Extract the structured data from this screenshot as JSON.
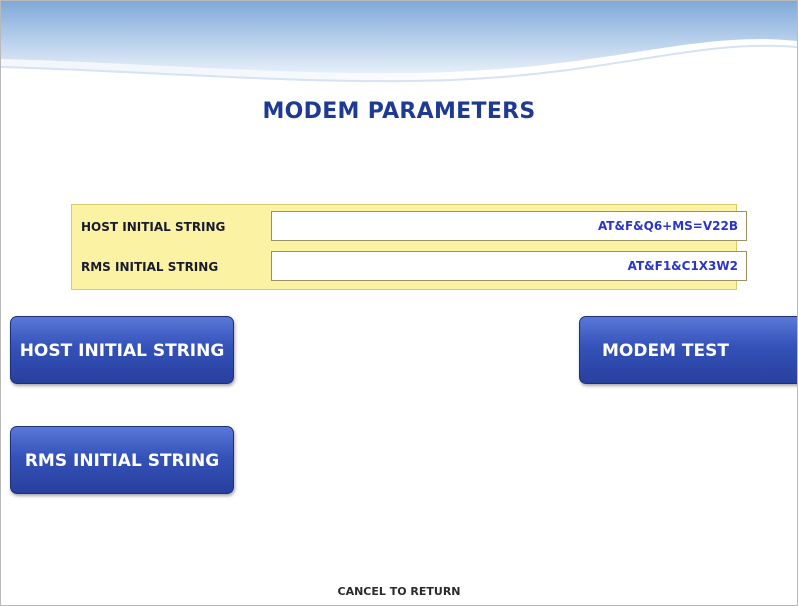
{
  "screen": {
    "title": "MODEM PARAMETERS",
    "footer": "CANCEL TO RETURN"
  },
  "parameters": [
    {
      "label": "HOST INITIAL STRING",
      "value": "AT&F&Q6+MS=V22B"
    },
    {
      "label": "RMS INITIAL STRING",
      "value": "AT&F1&C1X3W2"
    }
  ],
  "buttons": {
    "host_initial_string": "HOST INITIAL STRING",
    "rms_initial_string": "RMS INITIAL STRING",
    "modem_test": "MODEM TEST"
  },
  "colors": {
    "title": "#1f3a93",
    "panel_background": "#fbf3a3",
    "value_text": "#2a35c9",
    "button": "#3452b8"
  }
}
